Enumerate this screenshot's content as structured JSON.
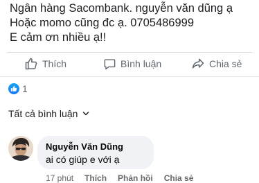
{
  "post": {
    "lines": [
      "Ngân hàng Sacombank. nguyễn văn dũng ạ",
      "Hoặc momo cũng đc ạ. 0705486999",
      "E cảm ơn nhiều ạ!!"
    ]
  },
  "actions": {
    "like_label": "Thích",
    "comment_label": "Bình luận",
    "share_label": "Chia sẻ"
  },
  "reactions": {
    "count": "1",
    "color": "#1877f2"
  },
  "comments_section": {
    "all_comments_label": "Tất cả bình luận"
  },
  "comment": {
    "author": "Nguyễn Văn Dũng",
    "text": "ai có giúp e với ạ",
    "time": "17 phút",
    "like_label": "Thích",
    "reply_label": "Phản hồi",
    "share_label": "Chia sẻ"
  }
}
